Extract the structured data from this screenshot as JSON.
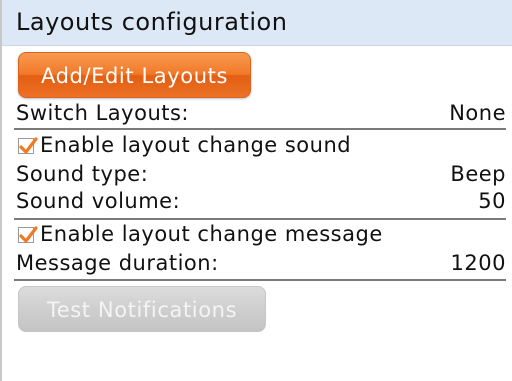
{
  "header": {
    "title": "Layouts configuration"
  },
  "buttons": {
    "add_edit_layouts": "Add/Edit Layouts",
    "test_notifications": "Test Notifications"
  },
  "switch_layouts": {
    "label": "Switch Layouts:",
    "value": "None"
  },
  "sound": {
    "enable_label": "Enable layout change sound",
    "enabled": true,
    "type_label": "Sound type:",
    "type_value": "Beep",
    "volume_label": "Sound volume:",
    "volume_value": "50"
  },
  "message": {
    "enable_label": "Enable layout change message",
    "enabled": true,
    "duration_label": "Message duration:",
    "duration_value": "1200"
  },
  "icons": {
    "checkbox_checked": "checkmark-icon"
  },
  "colors": {
    "title_bar": "#dce8f6",
    "accent_orange": "#f2792a",
    "disabled_gray": "#cfcfcf",
    "checkmark": "#f07a22"
  }
}
